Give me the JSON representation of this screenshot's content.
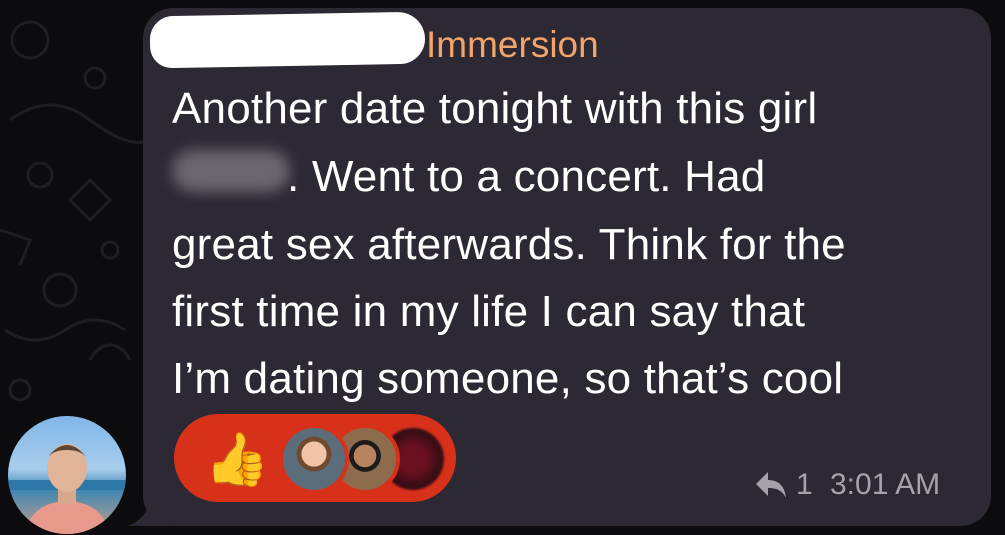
{
  "message": {
    "sender_name": "Immersion",
    "lines": [
      "Another date tonight with this girl",
      ". Went to a concert. Had",
      "great sex afterwards. Think for the",
      "first time in my life I can say that",
      "I’m dating someone, so that’s cool"
    ],
    "reply_count": "1",
    "time": "3:01 AM"
  },
  "reactions": {
    "emoji": "👍",
    "icon": "thumbs-up-icon",
    "reactor_count_shown": 3
  },
  "colors": {
    "background": "#0c0b0e",
    "bubble": "#2c2834",
    "sender_name": "#f2a46a",
    "message_text": "#ffffff",
    "reaction_pill": "#d8311a",
    "meta_text": "#a6a2ab"
  }
}
